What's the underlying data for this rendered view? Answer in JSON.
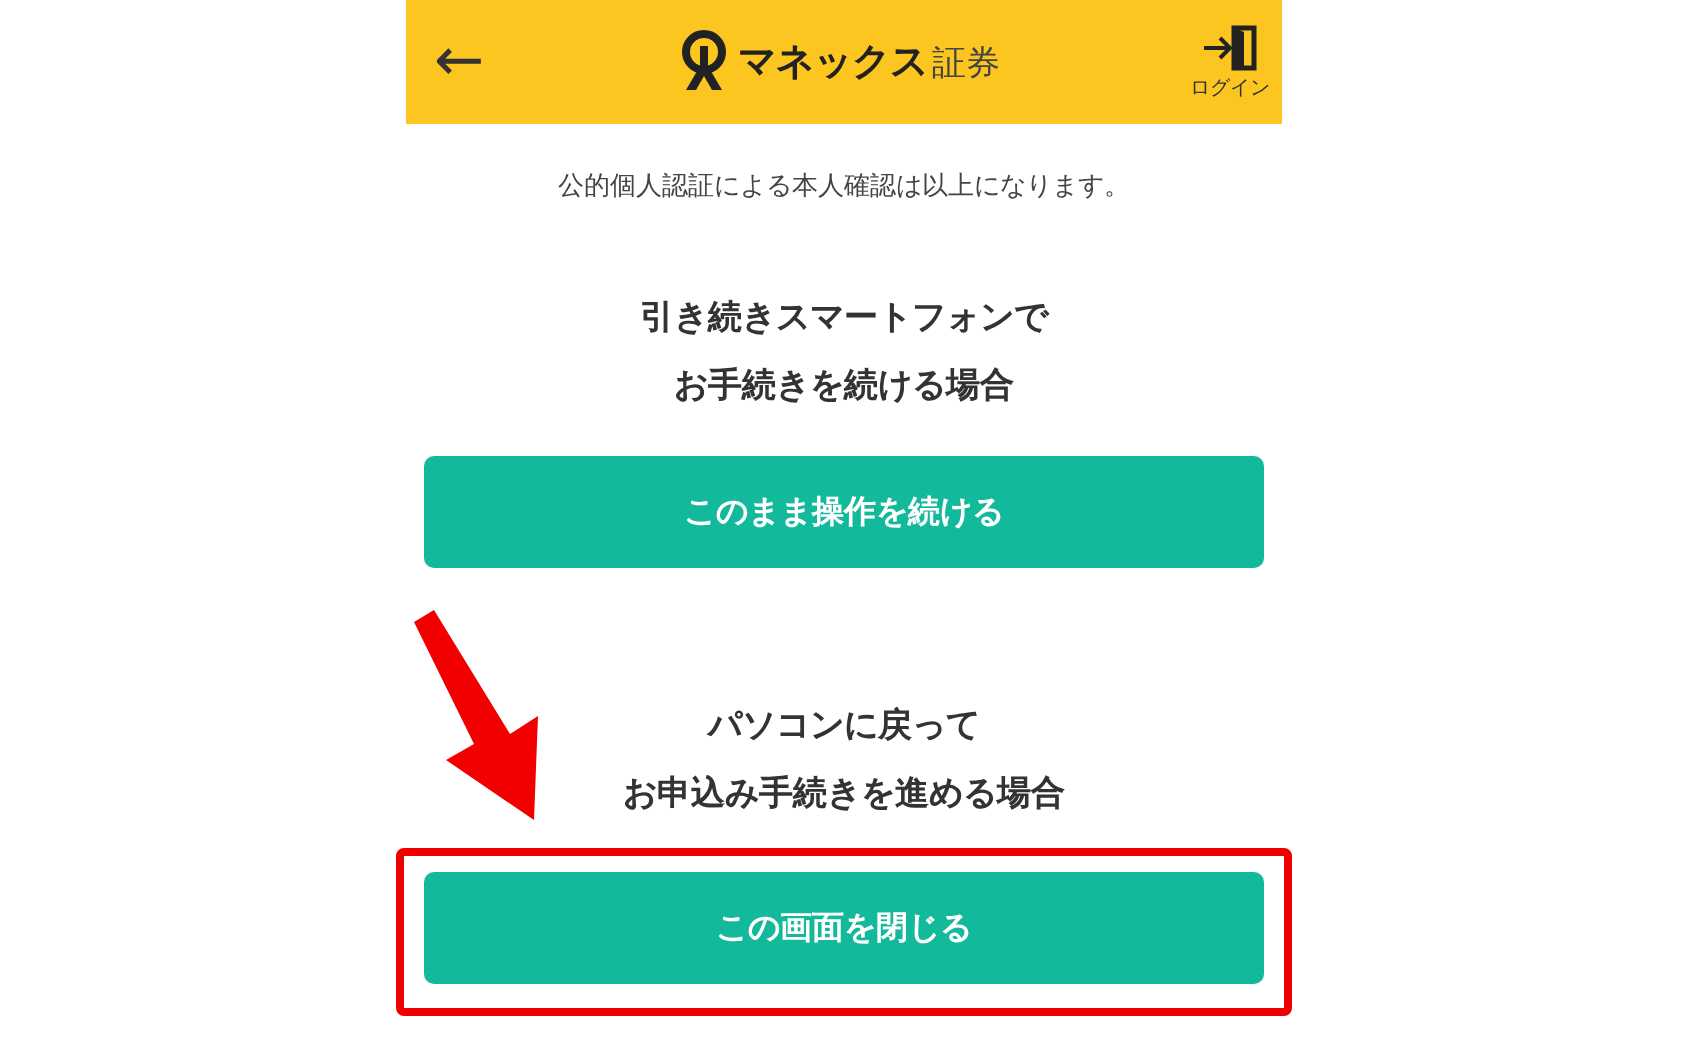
{
  "header": {
    "back_icon": "←",
    "logo": {
      "brand": "マネックス",
      "suffix": "証券"
    },
    "login_label": "ログイン"
  },
  "notice": "公的個人認証による本人確認は以上になります。",
  "sections": [
    {
      "heading_lines": [
        "引き続きスマートフォンで",
        "お手続きを続ける場合"
      ],
      "button": "このまま操作を続ける",
      "highlighted": false
    },
    {
      "heading_lines": [
        "パソコンに戻って",
        "お申込み手続きを進める場合"
      ],
      "button": "この画面を閉じる",
      "highlighted": true
    }
  ]
}
